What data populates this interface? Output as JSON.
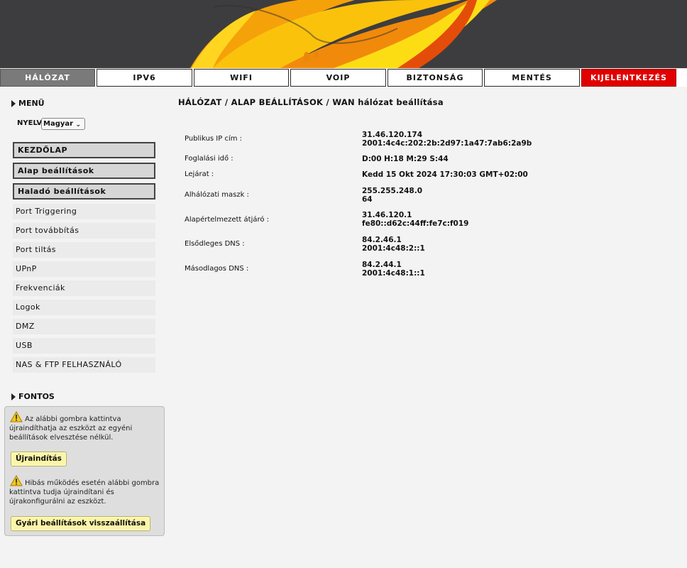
{
  "nav": {
    "tabs": [
      {
        "label": "HÁLÓZAT"
      },
      {
        "label": "IPV6"
      },
      {
        "label": "WIFI"
      },
      {
        "label": "VOIP"
      },
      {
        "label": "BIZTONSÁG"
      },
      {
        "label": "MENTÉS"
      },
      {
        "label": "KIJELENTKEZÉS"
      }
    ],
    "active_index": 0
  },
  "sidebar": {
    "menu_heading": "MENÜ",
    "language_label": "NYELV",
    "language_value": "Magyar",
    "main_buttons": [
      {
        "label": "KEZDŐLAP"
      },
      {
        "label": "Alap beállítások"
      },
      {
        "label": "Haladó beállítások"
      }
    ],
    "items": [
      {
        "label": "Port Triggering"
      },
      {
        "label": "Port továbbítás"
      },
      {
        "label": "Port tiltás"
      },
      {
        "label": "UPnP"
      },
      {
        "label": "Frekvenciák"
      },
      {
        "label": "Logok"
      },
      {
        "label": "DMZ"
      },
      {
        "label": "USB"
      },
      {
        "label": "NAS & FTP FELHASZNÁLÓ"
      }
    ],
    "important_heading": "FONTOS",
    "restart_text": "Az alábbi gombra kattintva újraindíthatja az eszközt az egyéni beállítások elvesztése nélkül.",
    "restart_button": "Újraindítás",
    "reset_text": "Hibás működés esetén alábbi gombra kattintva tudja újraindítani és újrakonfigurálni az eszközt.",
    "reset_button": "Gyári beállítások visszaállítása"
  },
  "main": {
    "breadcrumb": "HÁLÓZAT / ALAP BEÁLLÍTÁSOK / WAN hálózat beállítása",
    "rows": [
      {
        "label": "Publikus IP cím :",
        "line1": "31.46.120.174",
        "line2": "2001:4c4c:202:2b:2d97:1a47:7ab6:2a9b"
      },
      {
        "label": "Foglalási idő :",
        "line1": "D:00 H:18 M:29 S:44",
        "line2": ""
      },
      {
        "label": "Lejárat :",
        "line1": "Kedd 15 Okt 2024 17:30:03 GMT+02:00",
        "line2": ""
      },
      {
        "label": "Alhálózati maszk :",
        "line1": "255.255.248.0",
        "line2": "64"
      },
      {
        "label": "Alapértelmezett átjáró :",
        "line1": "31.46.120.1",
        "line2": "fe80::d62c:44ff:fe7c:f019"
      },
      {
        "label": "Elsődleges DNS :",
        "line1": "84.2.46.1",
        "line2": "2001:4c48:2::1"
      },
      {
        "label": "Másodlagos DNS :",
        "line1": "84.2.44.1",
        "line2": "2001:4c48:1::1"
      }
    ]
  },
  "colors": {
    "banner_bg": "#3d3d3f",
    "active_tab": "#7a7a7a",
    "logout_tab": "#e00000",
    "button_yellow": "#fbf5a8"
  },
  "icons": {
    "section_marker": "triangle-right-icon",
    "warning": "warning-icon"
  }
}
